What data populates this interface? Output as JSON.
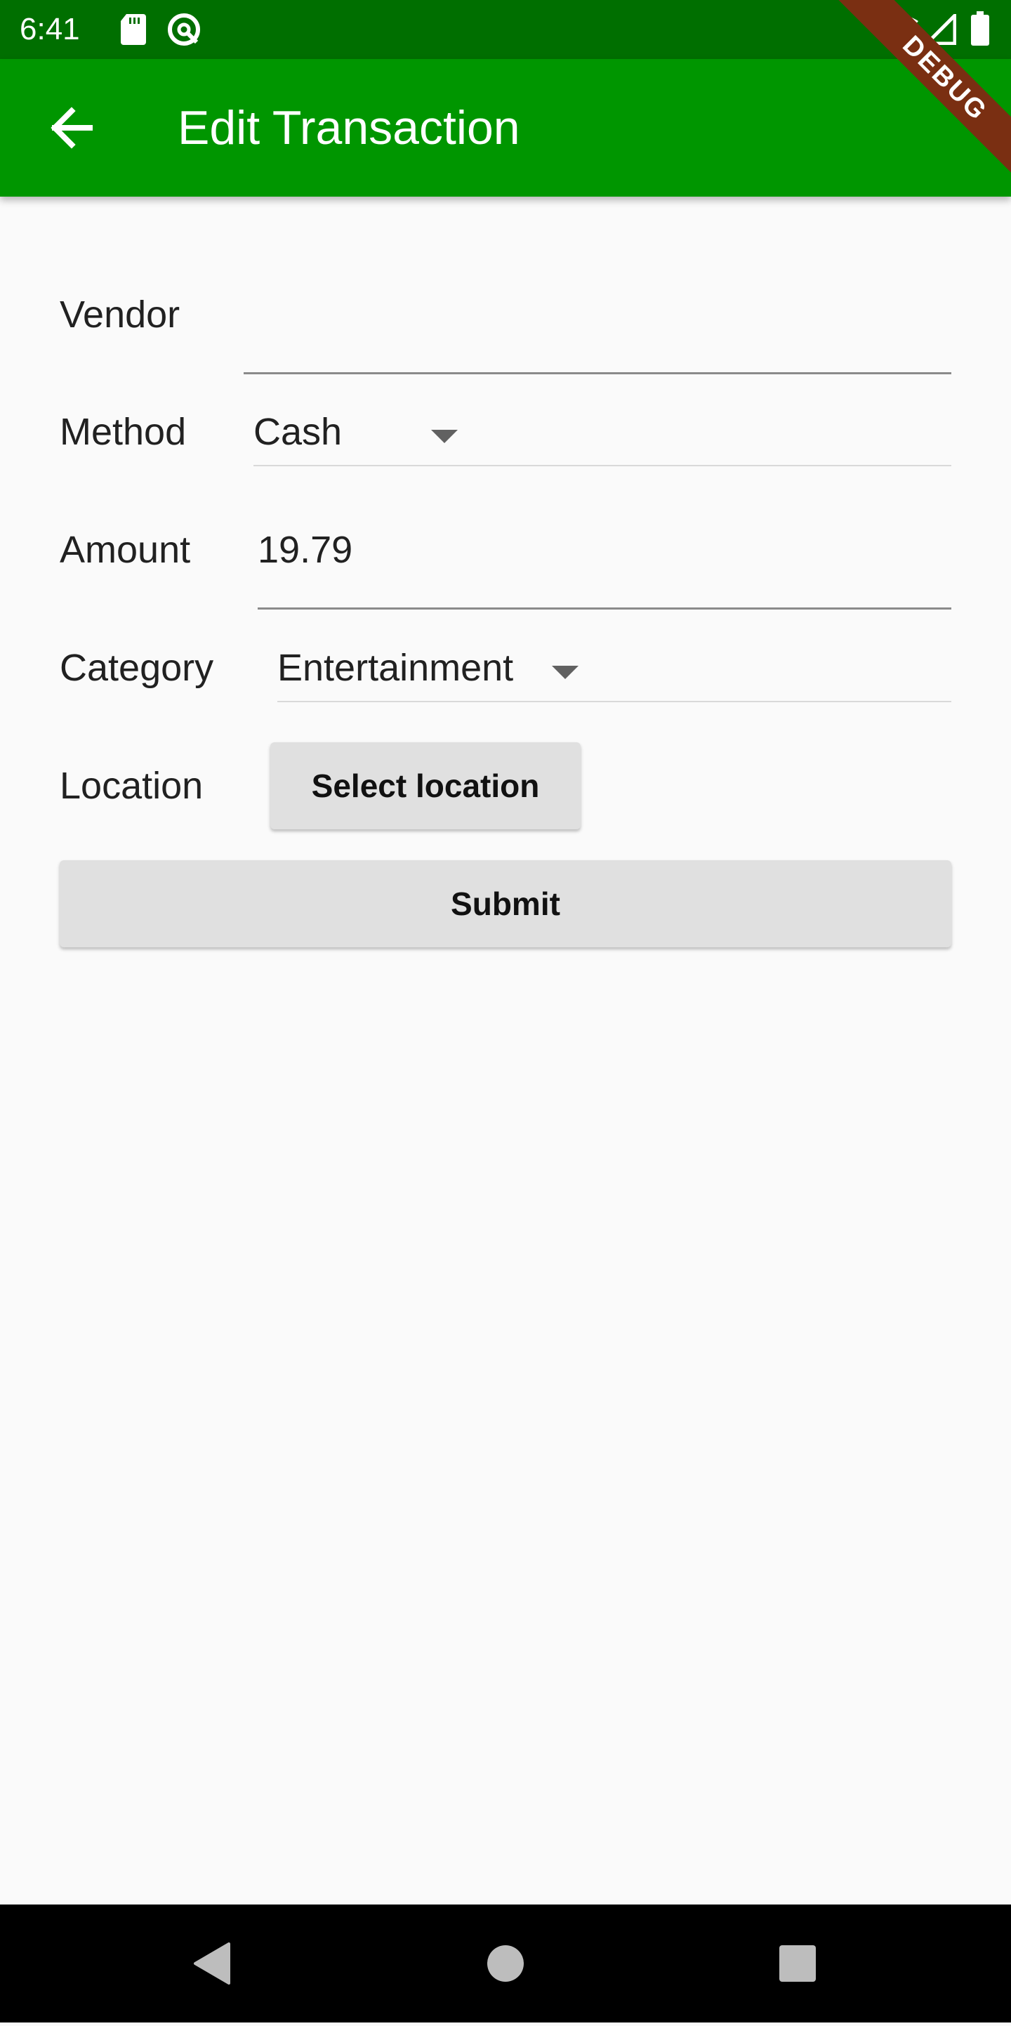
{
  "status_bar": {
    "time": "6:41",
    "icons": [
      "sd-card-icon",
      "sync-icon",
      "wifi-icon",
      "cell-signal-icon",
      "battery-icon"
    ]
  },
  "app_bar": {
    "title": "Edit Transaction",
    "back_icon": "arrow-back-icon",
    "background": "#009600",
    "status_background": "#006f00"
  },
  "debug_banner": "DEBUG",
  "form": {
    "vendor": {
      "label": "Vendor",
      "value": ""
    },
    "method": {
      "label": "Method",
      "selected": "Cash"
    },
    "amount": {
      "label": "Amount",
      "value": "19.79"
    },
    "category": {
      "label": "Category",
      "selected": "Entertainment"
    },
    "location": {
      "label": "Location",
      "button_label": "Select location"
    },
    "submit_label": "Submit"
  },
  "nav_bar": {
    "icons": [
      "back-triangle-icon",
      "home-circle-icon",
      "recents-square-icon"
    ]
  }
}
